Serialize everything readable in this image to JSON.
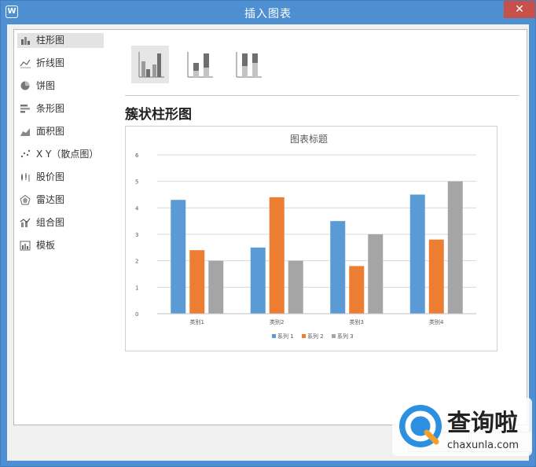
{
  "window": {
    "title": "插入图表",
    "close_label": "✕",
    "app_icon_letter": "W"
  },
  "sidebar": {
    "items": [
      {
        "label": "柱形图",
        "icon": "column-chart-icon",
        "selected": true
      },
      {
        "label": "折线图",
        "icon": "line-chart-icon"
      },
      {
        "label": "饼图",
        "icon": "pie-chart-icon"
      },
      {
        "label": "条形图",
        "icon": "bar-chart-icon"
      },
      {
        "label": "面积图",
        "icon": "area-chart-icon"
      },
      {
        "label": "X Y（散点图）",
        "icon": "scatter-chart-icon"
      },
      {
        "label": "股价图",
        "icon": "stock-chart-icon"
      },
      {
        "label": "雷达图",
        "icon": "radar-chart-icon"
      },
      {
        "label": "组合图",
        "icon": "combo-chart-icon"
      },
      {
        "label": "模板",
        "icon": "template-icon"
      }
    ]
  },
  "subtypes": [
    {
      "name": "clustered-column",
      "selected": true
    },
    {
      "name": "stacked-column"
    },
    {
      "name": "percent-stacked-column"
    }
  ],
  "preview": {
    "heading": "簇状柱形图"
  },
  "colors": {
    "series1": "#5b9bd5",
    "series2": "#ed7d31",
    "series3": "#a5a5a5",
    "title_bar": "#4d8fd1",
    "close": "#c7504a"
  },
  "chart_data": {
    "type": "bar",
    "title": "图表标题",
    "categories": [
      "类别1",
      "类别2",
      "类别3",
      "类别4"
    ],
    "series": [
      {
        "name": "系列 1",
        "values": [
          4.3,
          2.5,
          3.5,
          4.5
        ]
      },
      {
        "name": "系列 2",
        "values": [
          2.4,
          4.4,
          1.8,
          2.8
        ]
      },
      {
        "name": "系列 3",
        "values": [
          2,
          2,
          3,
          5
        ]
      }
    ],
    "ylim": [
      0,
      6
    ],
    "yticks": [
      0,
      1,
      2,
      3,
      4,
      5,
      6
    ],
    "grid": true,
    "legend": "bottom"
  },
  "watermark": {
    "text_cn": "查询啦",
    "text_url": "chaxunla.com"
  }
}
